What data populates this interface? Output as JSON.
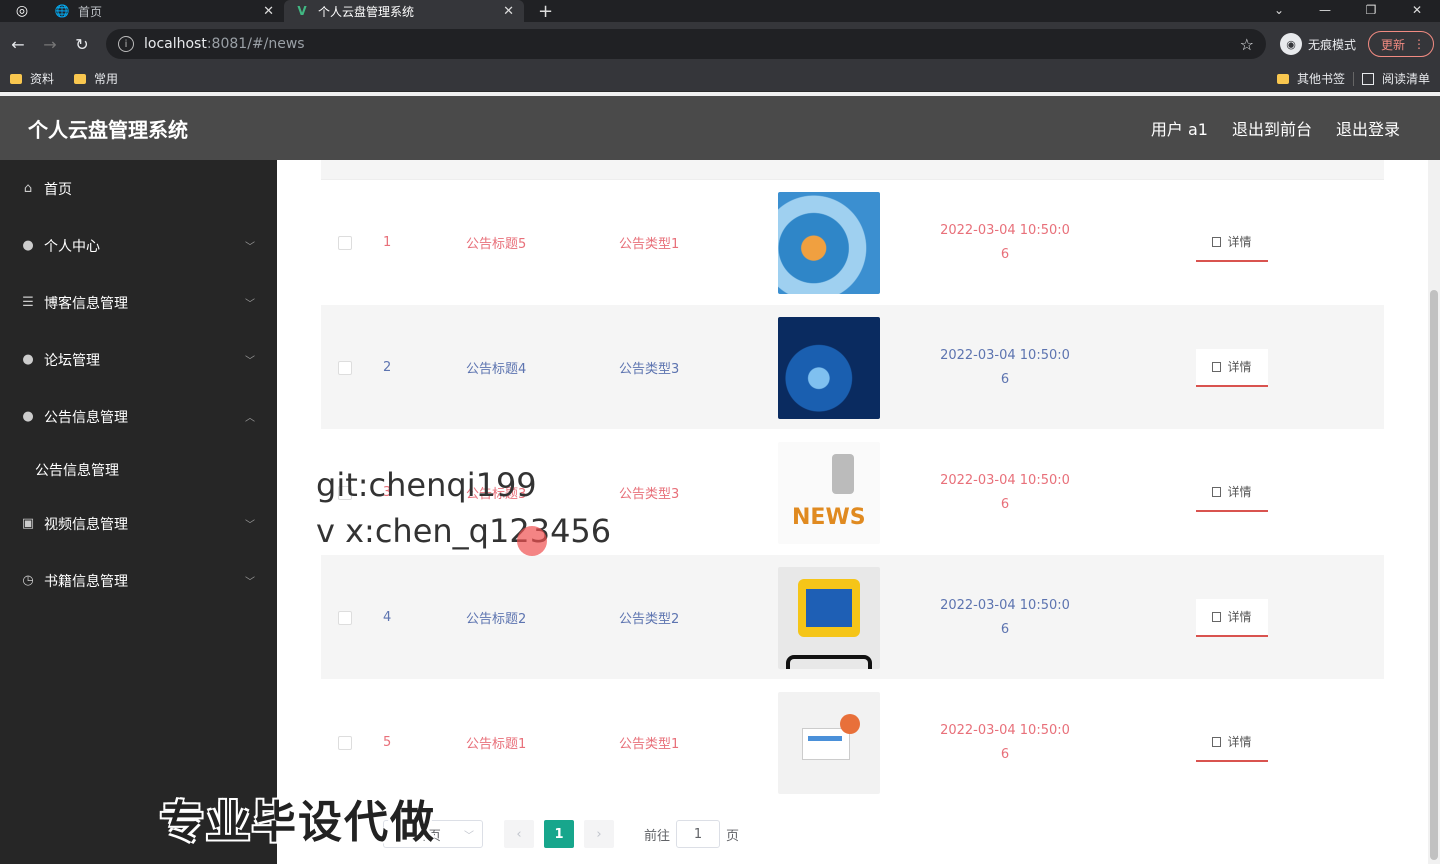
{
  "browser": {
    "tabs": [
      {
        "title": "首页"
      },
      {
        "title": "个人云盘管理系统"
      }
    ],
    "url_host": "localhost",
    "url_rest": ":8081/#/news",
    "incognito_label": "无痕模式",
    "update_label": "更新",
    "bookmarks": [
      "资料",
      "常用"
    ],
    "other_bookmarks": "其他书签",
    "reading_list": "阅读清单"
  },
  "header": {
    "title": "个人云盘管理系统",
    "user": "用户 a1",
    "back_to_front": "退出到前台",
    "logout": "退出登录"
  },
  "sidebar": {
    "items": [
      {
        "label": "首页",
        "icon": "home-icon"
      },
      {
        "label": "个人中心",
        "icon": "user-icon"
      },
      {
        "label": "博客信息管理",
        "icon": "list-icon"
      },
      {
        "label": "论坛管理",
        "icon": "user-icon"
      },
      {
        "label": "公告信息管理",
        "icon": "user-icon"
      },
      {
        "label": "视频信息管理",
        "icon": "video-icon"
      },
      {
        "label": "书籍信息管理",
        "icon": "clock-icon"
      }
    ],
    "active_sub": "公告信息管理"
  },
  "table": {
    "rows": [
      {
        "index": "1",
        "title": "公告标题5",
        "type": "公告类型1",
        "time1": "2022-03-04 10:50:0",
        "time2": "6",
        "action": "详情"
      },
      {
        "index": "2",
        "title": "公告标题4",
        "type": "公告类型3",
        "time1": "2022-03-04 10:50:0",
        "time2": "6",
        "action": "详情"
      },
      {
        "index": "3",
        "title": "公告标题3",
        "type": "公告类型3",
        "time1": "2022-03-04 10:50:0",
        "time2": "6",
        "action": "详情"
      },
      {
        "index": "4",
        "title": "公告标题2",
        "type": "公告类型2",
        "time1": "2022-03-04 10:50:0",
        "time2": "6",
        "action": "详情"
      },
      {
        "index": "5",
        "title": "公告标题1",
        "type": "公告类型1",
        "time1": "2022-03-04 10:50:0",
        "time2": "6",
        "action": "详情"
      }
    ]
  },
  "pagination": {
    "page_size": "10条/页",
    "current_page": "1",
    "goto_label": "前往",
    "goto_value": "1",
    "page_suffix": "页"
  },
  "overlay": {
    "line1": "git:chenqi199",
    "line2": "v x:chen_q123456",
    "bottom": "专业毕设代做"
  },
  "colors": {
    "accent": "#17a68c",
    "row_red": "#e8707a",
    "row_blue": "#5d74b0",
    "sidebar_bg": "#262626",
    "header_bg": "#4a4a4a"
  }
}
